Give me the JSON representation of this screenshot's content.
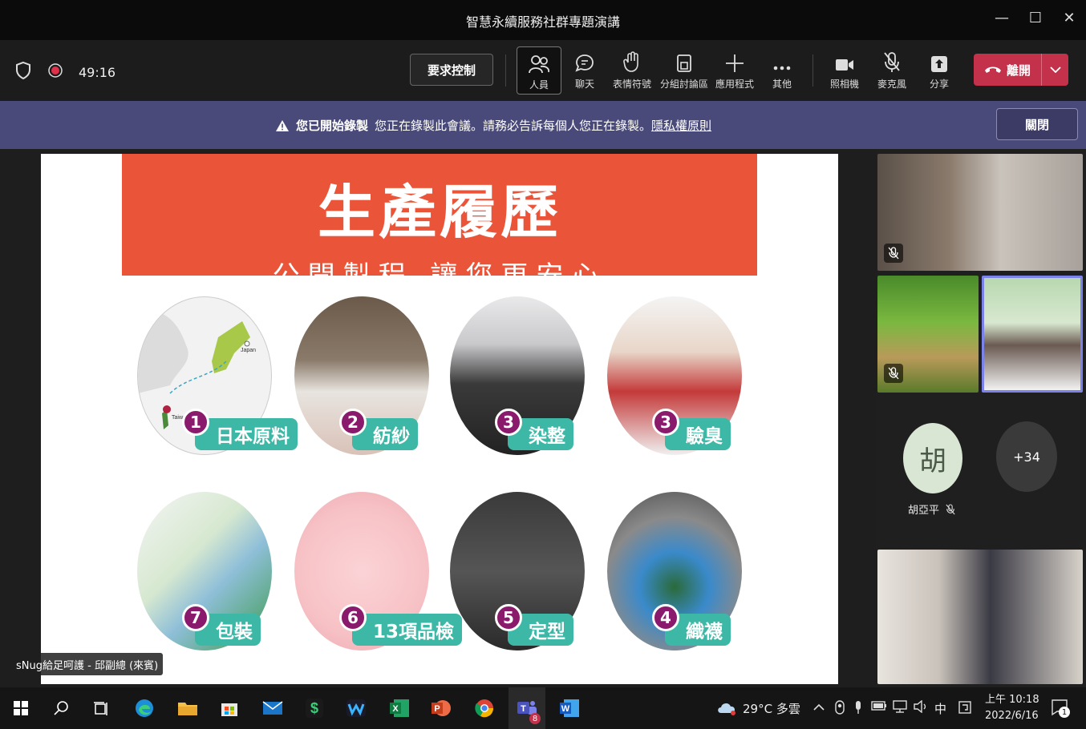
{
  "window": {
    "title": "智慧永續服務社群專題演講",
    "minimize": "—",
    "maximize": "☐",
    "close": "✕"
  },
  "toolbar": {
    "timer": "49:16",
    "request_control": "要求控制",
    "items": [
      {
        "label": "人員",
        "icon": "people-icon"
      },
      {
        "label": "聊天",
        "icon": "chat-icon"
      },
      {
        "label": "表情符號",
        "icon": "reactions-icon"
      },
      {
        "label": "分組討論區",
        "icon": "breakout-rooms-icon"
      },
      {
        "label": "應用程式",
        "icon": "apps-icon"
      },
      {
        "label": "其他",
        "icon": "more-icon"
      },
      {
        "label": "照相機",
        "icon": "camera-icon"
      },
      {
        "label": "麥克風",
        "icon": "microphone-off-icon"
      },
      {
        "label": "分享",
        "icon": "share-icon"
      }
    ],
    "leave": "離開"
  },
  "banner": {
    "bold": "您已開始錄製",
    "message": "您正在錄製此會議。請務必告訴每個人您正在錄製。",
    "link": "隱私權原則",
    "close": "關閉"
  },
  "slide": {
    "title": "生產履歷",
    "subtitle": "公開製程 讓您更安心",
    "map_labels": {
      "japan": "Japan",
      "taiwan": "Taiwan"
    },
    "steps": [
      {
        "num": "1",
        "label": "日本原料"
      },
      {
        "num": "2",
        "label": "紡紗"
      },
      {
        "num": "3",
        "label": "染整"
      },
      {
        "num": "3",
        "label": "驗臭"
      },
      {
        "num": "7",
        "label": "包裝"
      },
      {
        "num": "6",
        "label": "13項品檢"
      },
      {
        "num": "5",
        "label": "定型"
      },
      {
        "num": "4",
        "label": "織襪"
      }
    ]
  },
  "presenter_caption": "sNug給足呵護 - 邱副總 (來賓)",
  "participants": {
    "avatar_initial": "胡",
    "avatar_name": "胡亞平",
    "more_count": "+34"
  },
  "taskbar": {
    "weather": "29°C 多雲",
    "ime": "中",
    "time": "上午 10:18",
    "date": "2022/6/16",
    "teams_badge": "8",
    "notification_badge": "1"
  },
  "colors": {
    "leave": "#c4314b",
    "banner": "#4a4a7a",
    "slide_header": "#ea5539",
    "pill": "#3db8a6",
    "number": "#8a1a6b"
  }
}
